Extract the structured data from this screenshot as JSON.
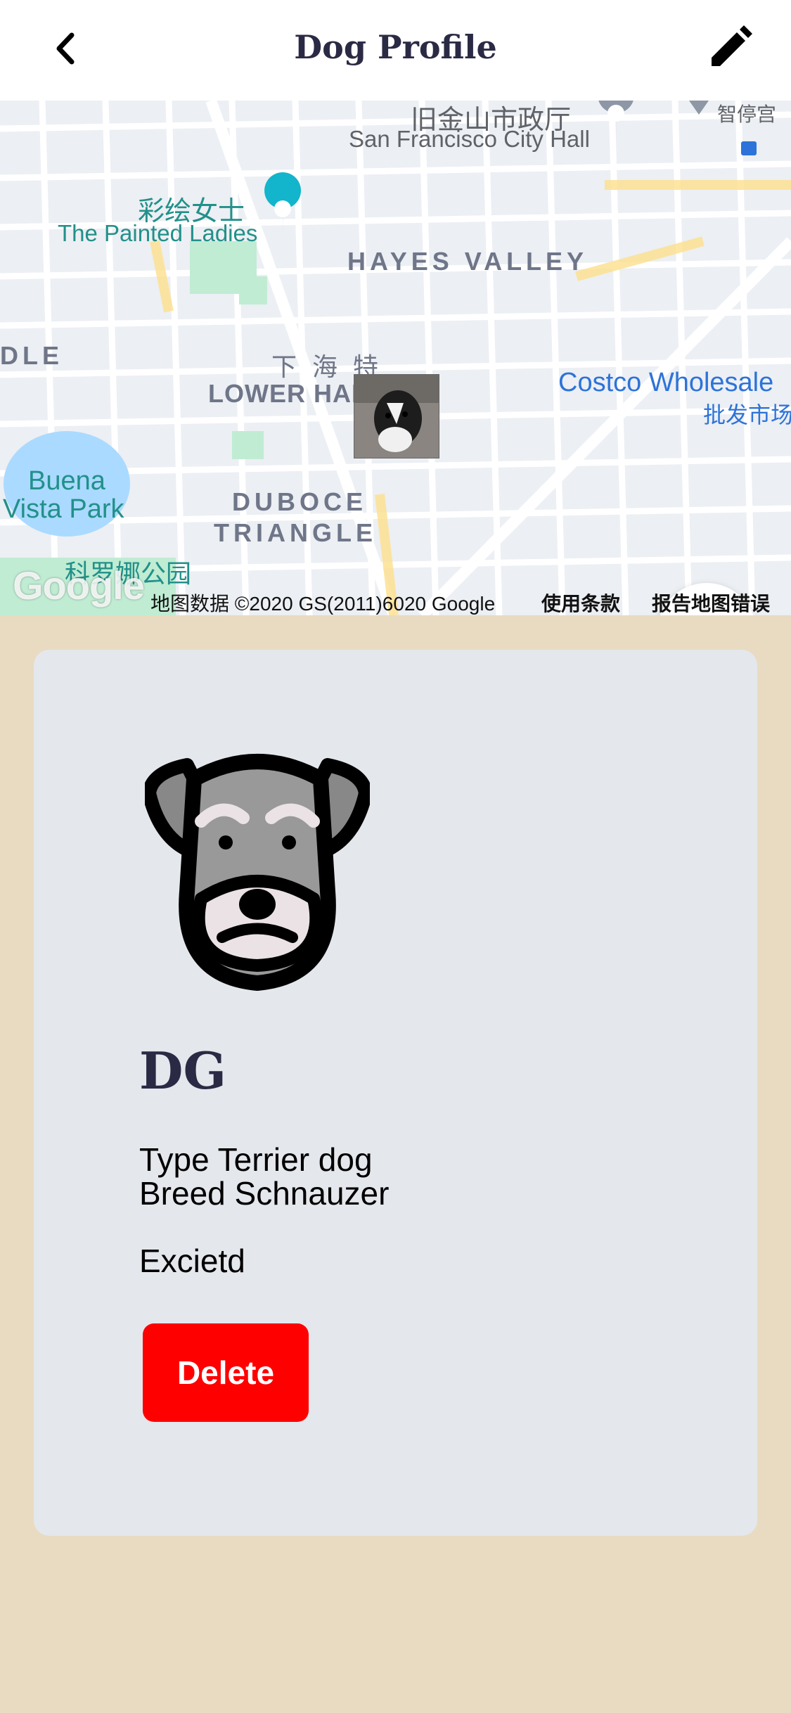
{
  "header": {
    "title": "Dog Profile",
    "back_icon": "chevron-left-icon",
    "edit_icon": "pencil-icon"
  },
  "map": {
    "labels": {
      "city_hall_cn": "旧金山市政厅",
      "city_hall_en": "San Francisco City Hall",
      "corner_cn": "智停宫",
      "painted_ladies_cn": "彩绘女士",
      "painted_ladies_en": "The Painted Ladies",
      "hayes_valley": "HAYES VALLEY",
      "dle": "DLE",
      "lower_haight_cn": "下 海 特",
      "lower_haight_en": "LOWER HAIGHT",
      "costco_en": "Costco Wholesale",
      "costco_cn": "批发市场",
      "buena_vista_1": "Buena",
      "buena_vista_2": "Vista Park",
      "duboce_1": "DUBOCE",
      "duboce_2": "TRIANGLE",
      "corona_cn": "科罗娜公园"
    },
    "google_logo": "Google",
    "attribution": {
      "map_data": "地图数据 ©2020 GS(2011)6020 Google",
      "terms": "使用条款",
      "report": "报告地图错误"
    },
    "fab_icon": "plus-icon",
    "colors": {
      "water": "#aadaff",
      "park": "#c0ecd3",
      "highlight_road": "#fde293"
    }
  },
  "dog": {
    "name": "DG",
    "type_line": "Type Terrier dog",
    "breed_line": "Breed Schnauzer",
    "mood": "Excietd"
  },
  "actions": {
    "delete_label": "Delete"
  },
  "colors": {
    "background": "#e8dbc1",
    "card": "#e4e7ec",
    "title_text": "#2b2a45",
    "delete_button": "#ff0000"
  }
}
